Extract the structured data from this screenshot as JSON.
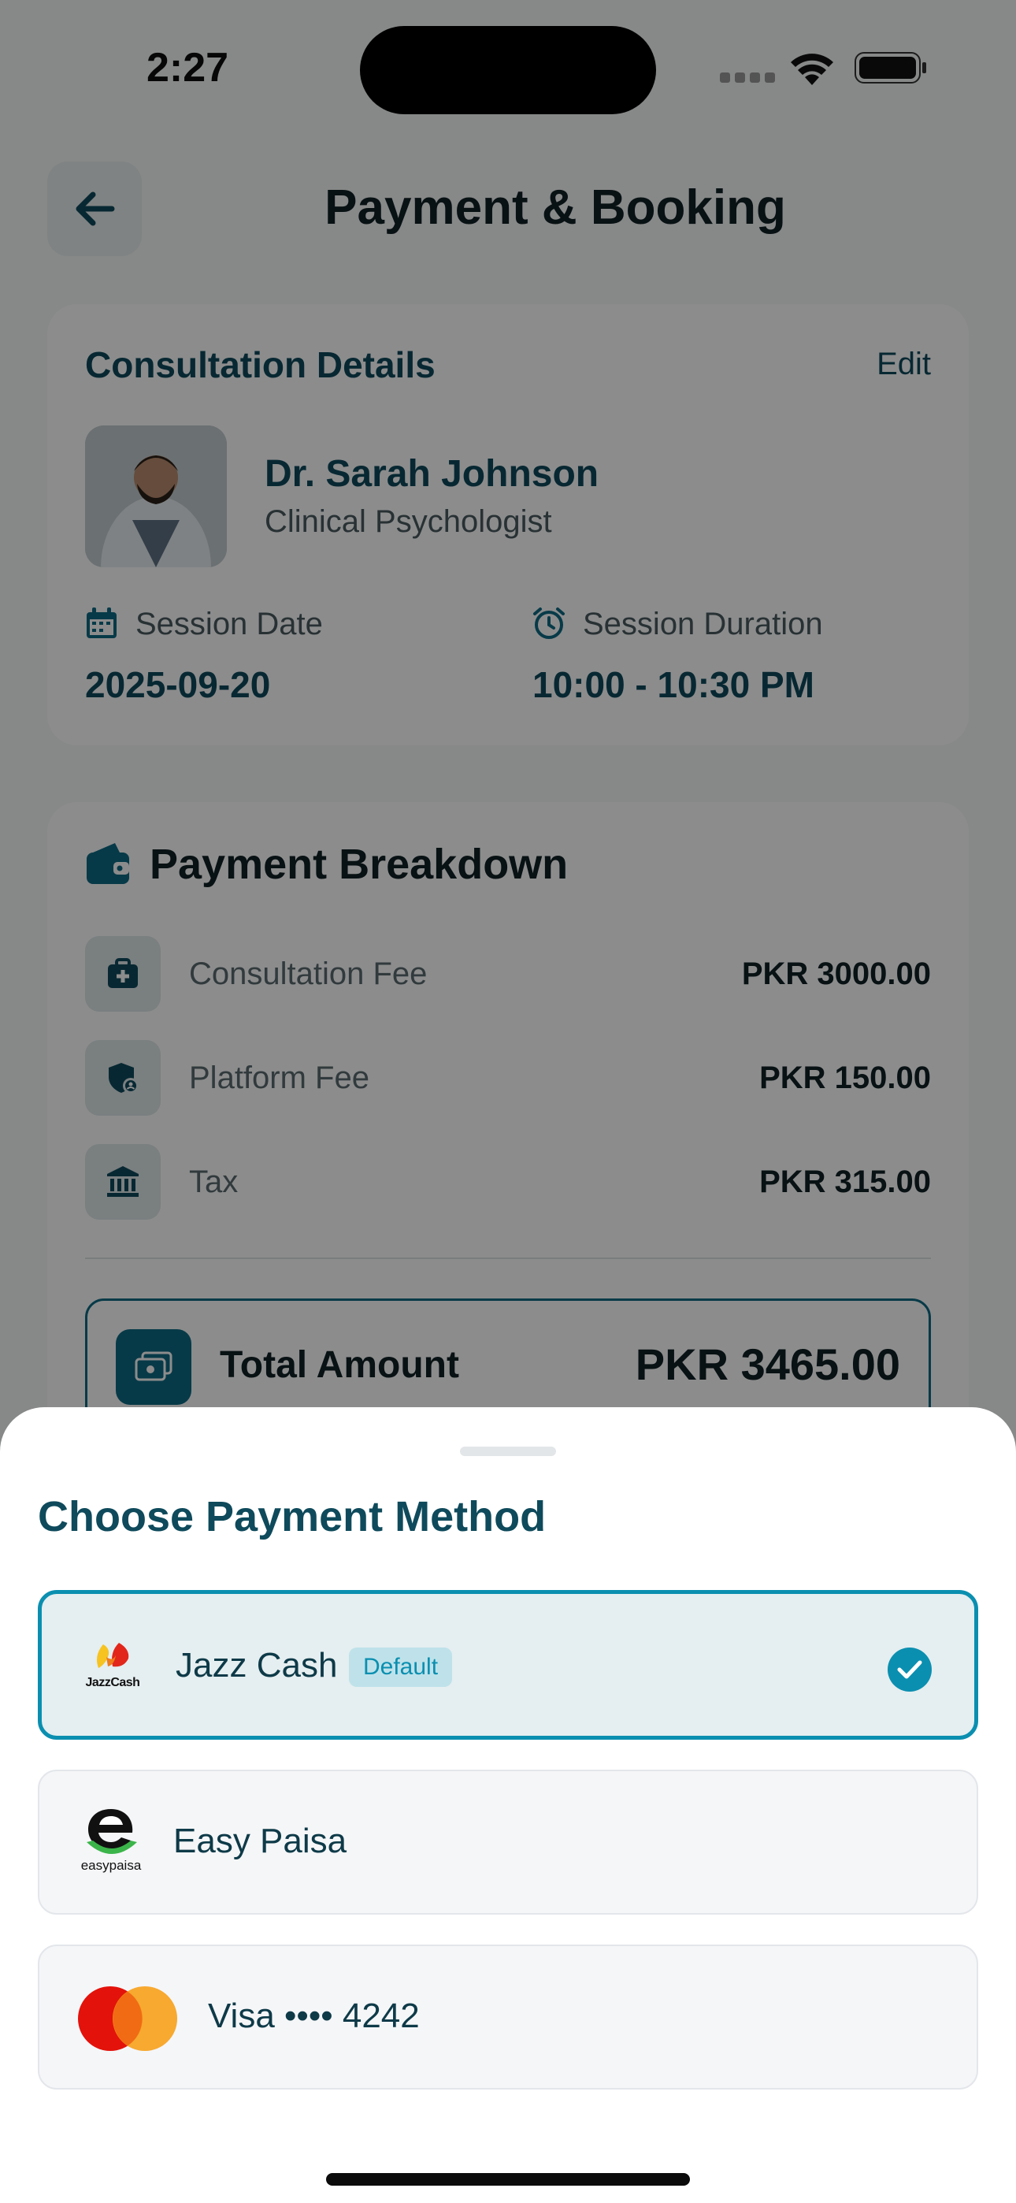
{
  "status_bar": {
    "time": "2:27"
  },
  "header": {
    "title": "Payment & Booking"
  },
  "consultation": {
    "title": "Consultation Details",
    "edit_label": "Edit",
    "doctor_name": "Dr. Sarah Johnson",
    "doctor_role": "Clinical Psychologist",
    "date_label": "Session Date",
    "date_value": "2025-09-20",
    "duration_label": "Session Duration",
    "duration_value": "10:00 - 10:30 PM"
  },
  "breakdown": {
    "title": "Payment Breakdown",
    "rows": [
      {
        "label": "Consultation Fee",
        "value": "PKR 3000.00",
        "icon": "medical-bag-icon"
      },
      {
        "label": "Platform Fee",
        "value": "PKR 150.00",
        "icon": "shield-icon"
      },
      {
        "label": "Tax",
        "value": "PKR 315.00",
        "icon": "bank-icon"
      }
    ],
    "total_label": "Total Amount",
    "total_value": "PKR 3465.00"
  },
  "sheet": {
    "title": "Choose Payment Method",
    "methods": [
      {
        "label": "Jazz Cash",
        "badge": "Default",
        "selected": true,
        "logo_text": "JazzCash"
      },
      {
        "label": "Easy Paisa",
        "selected": false,
        "logo_text": "easypaisa"
      },
      {
        "label": "Visa •••• 4242",
        "selected": false
      }
    ]
  },
  "colors": {
    "primary": "#0e4a5b",
    "accent": "#0b8fb0",
    "overlay": "rgba(0,0,0,0.45)"
  }
}
